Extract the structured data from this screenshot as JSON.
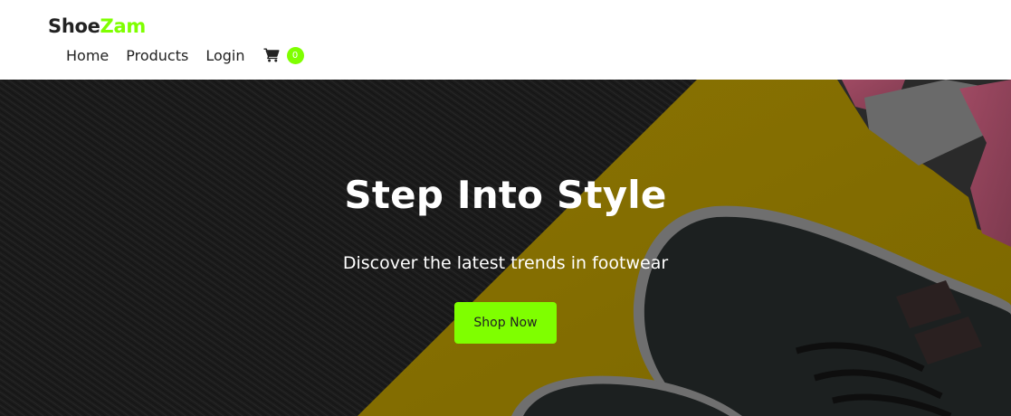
{
  "brand": {
    "logo_part1": "Shoe",
    "logo_part2": "Zam",
    "accent_color": "#7fff00"
  },
  "nav": {
    "items": [
      {
        "label": "Home"
      },
      {
        "label": "Products"
      },
      {
        "label": "Login"
      }
    ],
    "cart": {
      "icon": "shopping-cart-icon",
      "count": "0"
    }
  },
  "hero": {
    "title": "Step Into Style",
    "subtitle": "Discover the latest trends in footwear",
    "cta_label": "Shop Now",
    "background": "dark overlay photo of black sneakers on black fabric and yellow surface"
  }
}
